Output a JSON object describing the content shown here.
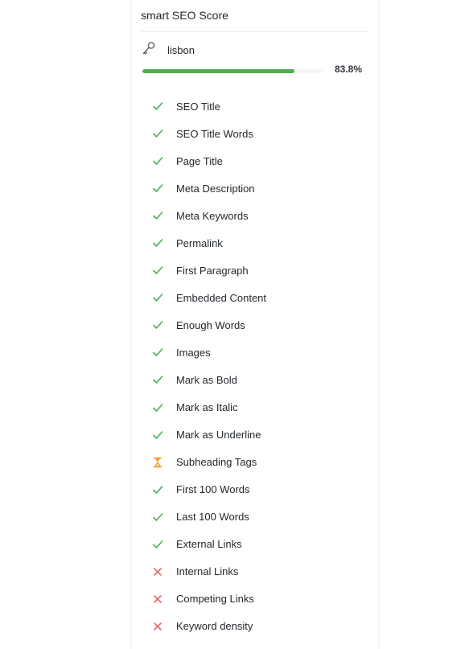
{
  "panel": {
    "title": "smart SEO Score",
    "keyword": "lisbon",
    "keyword_icon": "key-icon",
    "score_text": "83.8%",
    "score_fraction": 0.838,
    "colors": {
      "pass": "#4caf50",
      "pending": "#f0a020",
      "fail": "#e26a6a",
      "bar": "#4caf50"
    }
  },
  "checks": [
    {
      "label": "SEO Title",
      "status": "pass",
      "icon": "check-icon"
    },
    {
      "label": "SEO Title Words",
      "status": "pass",
      "icon": "check-icon"
    },
    {
      "label": "Page Title",
      "status": "pass",
      "icon": "check-icon"
    },
    {
      "label": "Meta Description",
      "status": "pass",
      "icon": "check-icon"
    },
    {
      "label": "Meta Keywords",
      "status": "pass",
      "icon": "check-icon"
    },
    {
      "label": "Permalink",
      "status": "pass",
      "icon": "check-icon"
    },
    {
      "label": "First Paragraph",
      "status": "pass",
      "icon": "check-icon"
    },
    {
      "label": "Embedded Content",
      "status": "pass",
      "icon": "check-icon"
    },
    {
      "label": "Enough Words",
      "status": "pass",
      "icon": "check-icon"
    },
    {
      "label": "Images",
      "status": "pass",
      "icon": "check-icon"
    },
    {
      "label": "Mark as Bold",
      "status": "pass",
      "icon": "check-icon"
    },
    {
      "label": "Mark as Italic",
      "status": "pass",
      "icon": "check-icon"
    },
    {
      "label": "Mark as Underline",
      "status": "pass",
      "icon": "check-icon"
    },
    {
      "label": "Subheading Tags",
      "status": "pending",
      "icon": "hourglass-icon"
    },
    {
      "label": "First 100 Words",
      "status": "pass",
      "icon": "check-icon"
    },
    {
      "label": "Last 100 Words",
      "status": "pass",
      "icon": "check-icon"
    },
    {
      "label": "External Links",
      "status": "pass",
      "icon": "check-icon"
    },
    {
      "label": "Internal Links",
      "status": "fail",
      "icon": "cross-icon"
    },
    {
      "label": "Competing Links",
      "status": "fail",
      "icon": "cross-icon"
    },
    {
      "label": "Keyword density",
      "status": "fail",
      "icon": "cross-icon"
    }
  ]
}
